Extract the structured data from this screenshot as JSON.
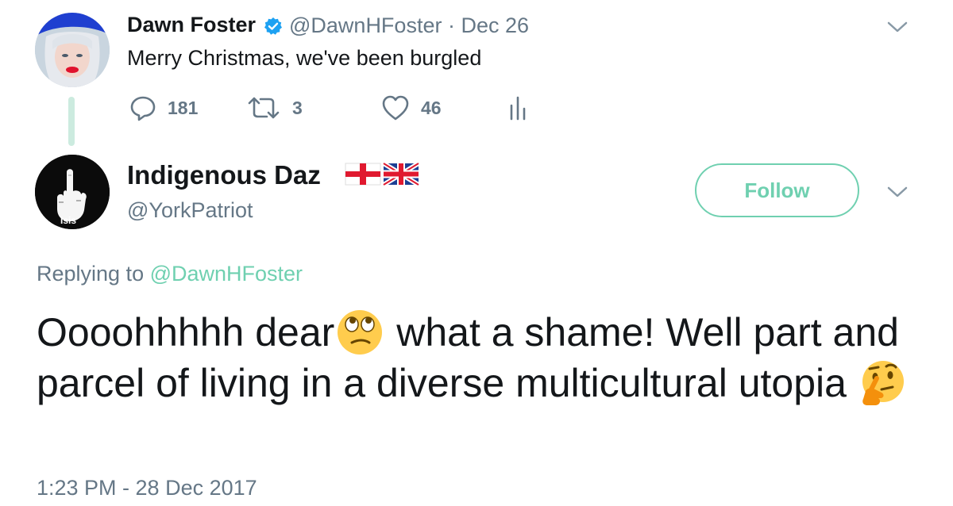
{
  "tweet1": {
    "name": "Dawn Foster",
    "handle": "@DawnHFoster",
    "date": "· Dec 26",
    "text": "Merry Christmas, we've been burgled",
    "replies": "181",
    "retweets": "3",
    "likes": "46"
  },
  "tweet2": {
    "name": "Indigenous Daz",
    "handle": "@YorkPatriot",
    "follow_label": "Follow",
    "replying_prefix": "Replying to ",
    "replying_mention": "@DawnHFoster",
    "text_part1": "Oooohhhhh dear",
    "text_part2": " what a shame! Well part and parcel of living in a diverse multicultural utopia ",
    "timestamp": "1:23 PM - 28 Dec 2017",
    "avatar_text": "Isis"
  },
  "colors": {
    "accent": "#6fd0b0",
    "secondary_text": "#657786",
    "verified": "#1da1f2"
  },
  "icons": [
    "verified-icon",
    "chevron-down-icon",
    "reply-icon",
    "retweet-icon",
    "like-icon",
    "analytics-icon",
    "eye-roll-emoji",
    "thinking-emoji",
    "england-flag",
    "uk-flag"
  ]
}
